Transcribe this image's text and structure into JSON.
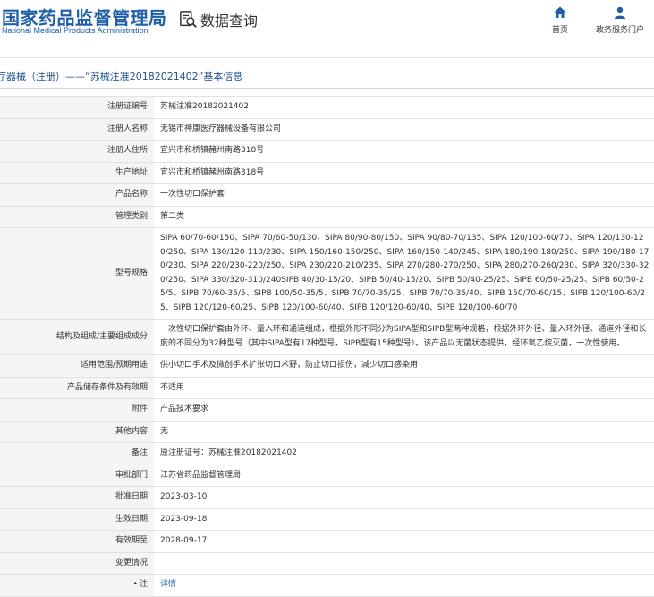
{
  "header": {
    "logo_cn": "国家药品监督管理局",
    "logo_en": "National Medical Products Administration",
    "search_label": "数据查询",
    "nav": [
      {
        "label": "首页",
        "icon": "home-icon"
      },
      {
        "label": "政务服务门户",
        "icon": "user-icon"
      }
    ],
    "accent_color": "#1e5fa8"
  },
  "page_title": "疗器械（注册）——“苏械注准20182021402”基本信息",
  "rows": [
    {
      "label": "注册证编号",
      "value": "苏械注准20182021402"
    },
    {
      "label": "注册人名称",
      "value": "无锡市神康医疗器械设备有限公司"
    },
    {
      "label": "注册人住所",
      "value": "宜兴市和桥镇赭州南路318号"
    },
    {
      "label": "生产地址",
      "value": "宜兴市和桥镇赭州南路318号"
    },
    {
      "label": "产品名称",
      "value": "一次性切口保护套"
    },
    {
      "label": "管理类别",
      "value": "第二类"
    },
    {
      "label": "型号规格",
      "value": "SIPA 60/70-60/150、SIPA 70/60-50/130、SIPA 80/90-80/150、SIPA 90/80-70/135、SIPA 120/100-60/70、SIPA 120/130-120/250、SIPA 130/120-110/230、SIPA 150/160-150/250、SIPA 160/150-140/245、SIPA 180/190-180/250、SIPA 190/180-170/230、SIPA 220/230-220/250、SIPA 230/220-210/235、SIPA 270/280-270/250、SIPA 280/270-260/230、SIPA 320/330-320/250、SIPA 330/320-310/240SIPB 40/30-15/20、SIPB 50/40-15/20、SIPB 50/40-25/25、SIPB 60/50-25/25、SIPB 60/50-25/5、SIPB 70/60-35/5、SIPB 100/50-35/5、SIPB 70/70-35/25、SIPB 70/70-35/40、SIPB 150/70-60/15、SIPB 120/100-60/25、SIPB 120/120-60/25、SIPB 120/100-60/40、SIPB 120/120-60/40、SIPB 120/100-60/70"
    },
    {
      "label": "结构及组成/主要组成成分",
      "value": "一次性切口保护套由外环、量入环和通道组成，根据外形不同分为SIPA型和SIPB型两种规格，根据外环外径、量入环外径、通道外径和长度的不同分为32种型号（其中SIPA型有17种型号，SIPB型有15种型号）。该产品以无菌状态提供，经环氧乙烷灭菌，一次性使用。"
    },
    {
      "label": "适用范围/预期用途",
      "value": "供小切口手术及微创手术扩张切口术野，防止切口损伤，减少切口感染用"
    },
    {
      "label": "产品储存条件及有效期",
      "value": "不适用"
    },
    {
      "label": "附件",
      "value": "产品技术要求"
    },
    {
      "label": "其他内容",
      "value": "无"
    },
    {
      "label": "备注",
      "value": "原注册证号：苏械注准20182021402"
    },
    {
      "label": "审批部门",
      "value": "江苏省药品监督管理局"
    },
    {
      "label": "批准日期",
      "value": "2023-03-10"
    },
    {
      "label": "生效日期",
      "value": "2023-09-18"
    },
    {
      "label": "有效期至",
      "value": "2028-09-17"
    },
    {
      "label": "变更情况",
      "value": ""
    }
  ],
  "note_row": {
    "label": "注",
    "icon": "bulb-icon",
    "link_text": "详情",
    "link_color": "#2d6bbd"
  }
}
